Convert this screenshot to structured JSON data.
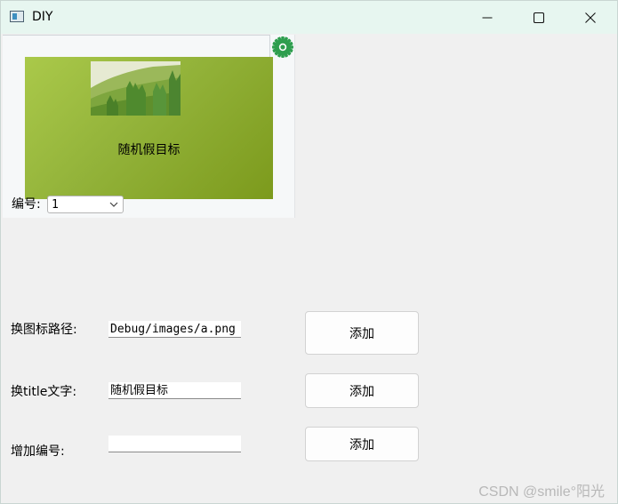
{
  "window": {
    "title": "DIY"
  },
  "card": {
    "title": "随机假目标",
    "number_label": "编号:",
    "number_selected": "1"
  },
  "form": {
    "icon_path": {
      "label": "换图标路径:",
      "value": "Debug/images/a.png",
      "button": "添加"
    },
    "title_text": {
      "label": "换title文字:",
      "value": "随机假目标",
      "button": "添加"
    },
    "add_number": {
      "label": "增加编号:",
      "value": "",
      "button": "添加"
    }
  },
  "watermark": "CSDN @smile°阳光",
  "colors": {
    "titlebar": "#e7f6f0",
    "card_green": "#93b33a",
    "settings_icon": "#2e9e4e"
  },
  "icons": {
    "app": "window-app-icon",
    "settings": "gear-icon",
    "minimize": "minimize-icon",
    "maximize": "maximize-icon",
    "close": "close-icon",
    "dropdown": "chevron-down-icon"
  }
}
